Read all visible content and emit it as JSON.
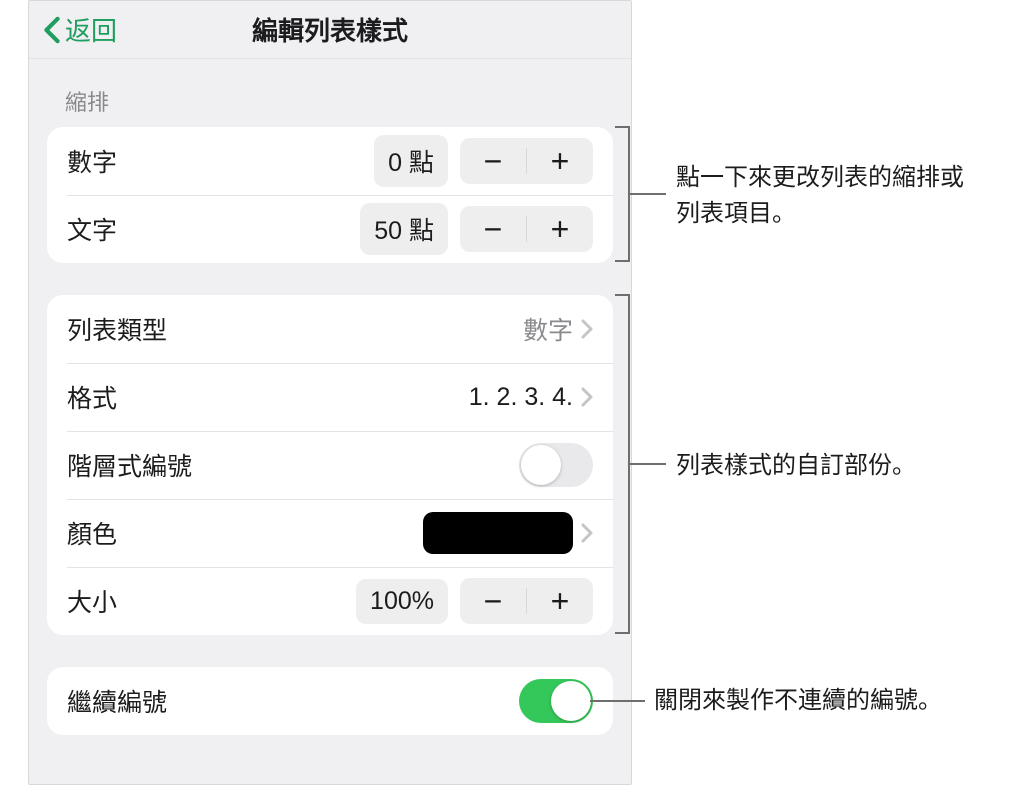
{
  "header": {
    "back_label": "返回",
    "title": "編輯列表樣式"
  },
  "sections": {
    "indent": {
      "header": "縮排",
      "rows": {
        "number": {
          "label": "數字",
          "value": "0 點"
        },
        "text": {
          "label": "文字",
          "value": "50 點"
        }
      }
    },
    "style": {
      "rows": {
        "list_type": {
          "label": "列表類型",
          "value": "數字"
        },
        "format": {
          "label": "格式",
          "value": "1. 2. 3. 4."
        },
        "tiered": {
          "label": "階層式編號",
          "on": false
        },
        "color": {
          "label": "顏色",
          "swatch": "#000000"
        },
        "size": {
          "label": "大小",
          "value": "100%"
        }
      }
    },
    "continue": {
      "rows": {
        "continue_numbering": {
          "label": "繼續編號",
          "on": true
        }
      }
    }
  },
  "annotations": {
    "a1": "點一下來更改列表的縮排或列表項目。",
    "a2": "列表樣式的自訂部份。",
    "a3": "關閉來製作不連續的編號。"
  }
}
